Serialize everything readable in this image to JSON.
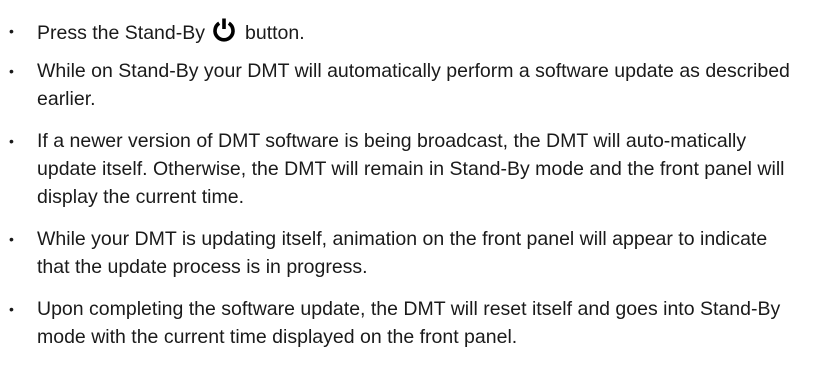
{
  "bullet_symbol": "•",
  "items": [
    {
      "text_before": "Press the Stand-By",
      "icon": "power-icon",
      "text_after": "button."
    },
    {
      "text": "While on Stand-By your DMT will automatically perform a software update as described earlier."
    },
    {
      "text": "If a newer version of DMT software is being broadcast, the DMT will auto-matically update itself.  Otherwise, the DMT will remain in Stand-By mode and the front panel will display the current time."
    },
    {
      "text": "While your DMT is updating itself, animation on the front panel will appear to indicate that the update process is in progress."
    },
    {
      "text": "Upon completing the software update, the DMT will reset itself and goes into Stand-By mode with the current time displayed on the front panel."
    }
  ]
}
